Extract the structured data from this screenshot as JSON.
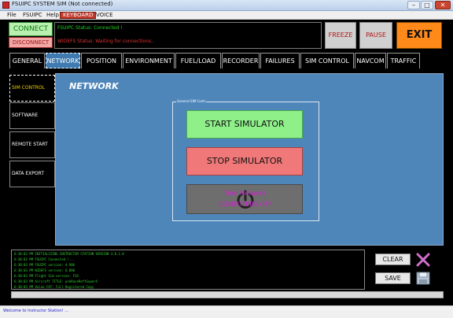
{
  "window": {
    "title": "FSUIPC SYSTEM SIM (Not connected)",
    "minimize_label": "–",
    "maximize_label": "□",
    "close_label": "✕"
  },
  "menubar": {
    "items": [
      "File",
      "FSUIPC",
      "Help",
      "KEYBOARD",
      "VOICE"
    ]
  },
  "controls": {
    "connect_label": "CONNECT",
    "disconnect_label": "DISCONNECT",
    "freeze_label": "FREEZE",
    "pause_label": "PAUSE",
    "exit_label": "EXIT"
  },
  "status": {
    "fsuipc": "FSUIPC Status: Connected !",
    "widefs": "WIDEFS Status: Waiting for connections.."
  },
  "tabs": [
    "GENERAL",
    "NETWORK",
    "POSITION",
    "ENVIRONMENT",
    "FUEL/LOAD",
    "RECORDER",
    "FAILURES",
    "SIM CONTROL",
    "NAVCOM",
    "TRAFFIC"
  ],
  "active_tab": "NETWORK",
  "side_nav": [
    "SIM CONTROL",
    "SOFTWARE",
    "REMOTE START",
    "DATA EXPORT"
  ],
  "main": {
    "title": "NETWORK",
    "group_label": "General SIM Contr",
    "start_label": "START SIMULATOR",
    "stop_label": "STOP SIMULATOR",
    "power_line1": "Turn Network",
    "power_line2": "COMPUTERS OFF"
  },
  "log": [
    "6:30:03 PM INITIALIZING INSTRUCTOR STATION VERSION 3.0.1.0",
    "6:30:03 PM FSUIPC Connected !...",
    "6:30:03 PM FSUIPC version: 4.906",
    "6:30:03 PM WIDEFS version: 6.880",
    "6:30:03 PM Flight Sim version: FSX",
    "6:30:03 PM Aircraft TITLE: pskRaceRaftSuperX",
    "6:30:03 PM Value CAT: Full Registered Copy"
  ],
  "log_actions": {
    "clear_label": "CLEAR",
    "save_label": "SAVE"
  },
  "statusbar": {
    "text": "Welcome to Instructor Station! ..."
  },
  "colors": {
    "panel_blue": "#4f86b9",
    "connect_green": "#b9f0b0",
    "disconnect_red": "#f3a6a6",
    "start_green": "#8ff08a",
    "stop_red": "#f07878",
    "exit_orange": "#ff8a1a",
    "log_green": "#30d030"
  }
}
